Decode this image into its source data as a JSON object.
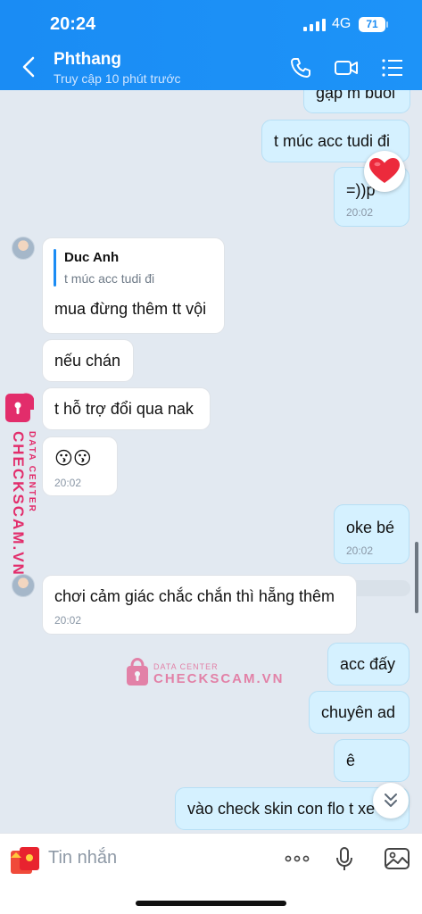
{
  "status_bar": {
    "time": "20:24",
    "network": "4G",
    "battery": "71"
  },
  "header": {
    "title": "Phthang",
    "subtitle": "Truy cập 10 phút trước"
  },
  "messages": {
    "m0": {
      "text": "gặp m buổi"
    },
    "m1": {
      "text": "t múc acc tudi đi"
    },
    "m2": {
      "text": "=))p",
      "time": "20:02"
    },
    "m3": {
      "quote_author": "Duc Anh",
      "quote_text": "t múc acc tudi đi",
      "text": "mua đừng thêm tt vội"
    },
    "m4": {
      "text": "nếu chán"
    },
    "m5": {
      "text": "t hỗ trợ đổi qua nak"
    },
    "m6": {
      "text": "😗😗",
      "time": "20:02"
    },
    "m7": {
      "text": "oke bé",
      "time": "20:02"
    },
    "m8": {
      "text": "chơi cảm giác chắc chắn thì hẵng thêm",
      "time": "20:02"
    },
    "m9": {
      "text": "acc đấy"
    },
    "m10": {
      "text": "chuyên ad"
    },
    "m11": {
      "text": "ê"
    },
    "m12": {
      "text": "vào check skin con flo t xe"
    }
  },
  "watermark": {
    "line1": "DATA CENTER",
    "line2": "CHECKSCAM.VN"
  },
  "input": {
    "placeholder": "Tin nhắn"
  },
  "colors": {
    "header": "#1a8cf4",
    "sent_bubble": "#d5f1ff",
    "received_bubble": "#ffffff",
    "watermark": "#e22d6b"
  }
}
